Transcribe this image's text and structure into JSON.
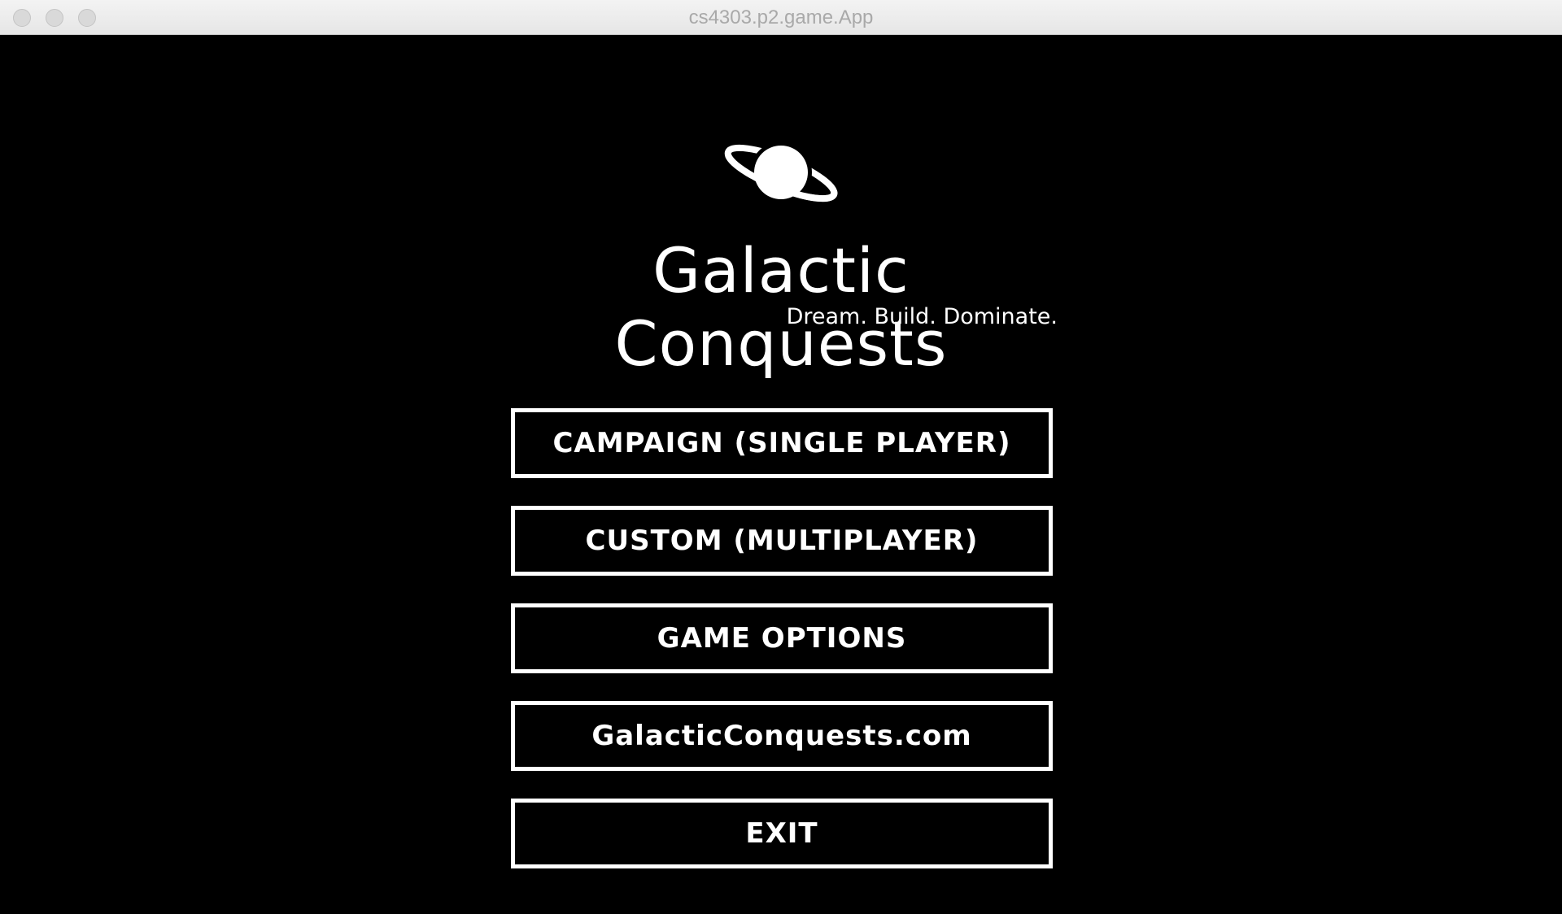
{
  "window": {
    "title": "cs4303.p2.game.App"
  },
  "logo": {
    "icon": "planet-icon"
  },
  "header": {
    "title": "Galactic Conquests",
    "tagline": "Dream. Build. Dominate."
  },
  "menu": {
    "campaign": "CAMPAIGN (SINGLE PLAYER)",
    "custom": "CUSTOM (MULTIPLAYER)",
    "options": "GAME OPTIONS",
    "website": "GalacticConquests.com",
    "exit": "EXIT"
  },
  "colors": {
    "background": "#000000",
    "foreground": "#ffffff"
  }
}
